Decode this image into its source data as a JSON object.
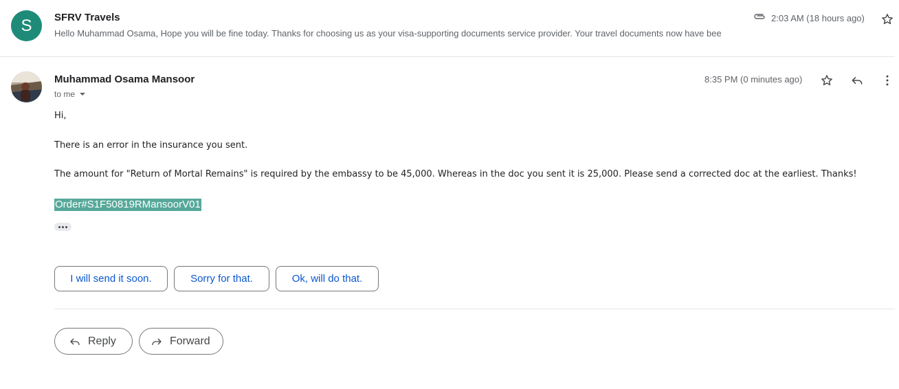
{
  "collapsed_message": {
    "avatar_letter": "S",
    "sender": "SFRV Travels",
    "snippet": "Hello Muhammad Osama, Hope you will be fine today. Thanks for choosing us as your visa-supporting documents service provider. Your travel documents now have bee",
    "time": "2:03 AM (18 hours ago)",
    "has_attachment": true,
    "starred": false
  },
  "expanded_message": {
    "sender": "Muhammad Osama Mansoor",
    "recipient": "to me",
    "time": "8:35 PM (0 minutes ago)",
    "starred": false,
    "body": {
      "greeting": "Hi,",
      "line1": "There is an error in the insurance you sent.",
      "line2": "The amount for \"Return of Mortal Remains\" is required by the embassy to be 45,000. Whereas in the doc you sent it is 25,000. Please send a corrected doc at the earliest. Thanks!",
      "order_ref": "Order#S1F50819RMansoorV01"
    }
  },
  "smart_replies": [
    {
      "label": "I will send it soon."
    },
    {
      "label": "Sorry for that."
    },
    {
      "label": "Ok, will do that."
    }
  ],
  "actions": {
    "reply_label": "Reply",
    "forward_label": "Forward"
  },
  "colors": {
    "avatar_bg": "#1e8b78",
    "order_highlight": "#56a89a",
    "smart_reply_text": "#0b57d0"
  },
  "icons": [
    "paperclip-icon",
    "star-icon",
    "reply-icon",
    "more-vert-icon",
    "dropdown-arrow-icon",
    "forward-icon"
  ]
}
